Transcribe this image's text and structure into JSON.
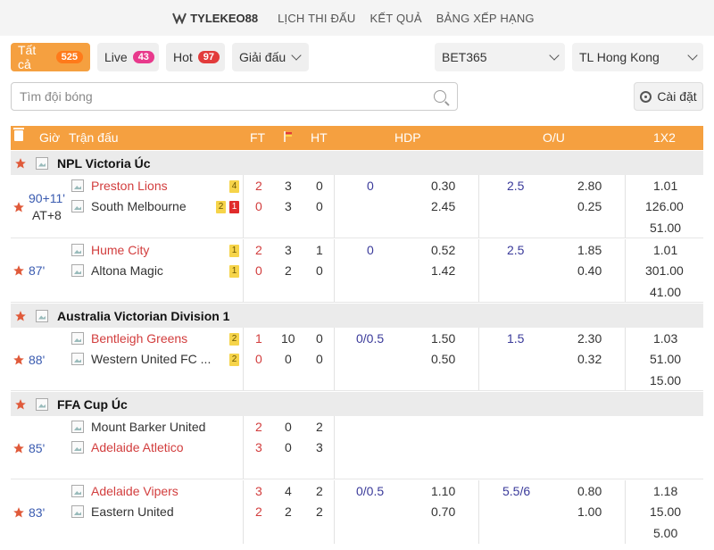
{
  "nav": {
    "brand": "TYLEKEO88",
    "links": [
      "LỊCH THI ĐẤU",
      "KẾT QUẢ",
      "BẢNG XẾP HẠNG"
    ]
  },
  "filters": {
    "all": {
      "label": "Tất cả",
      "count": "525"
    },
    "live": {
      "label": "Live",
      "count": "43"
    },
    "hot": {
      "label": "Hot",
      "count": "97"
    },
    "league": {
      "label": "Giải đấu"
    },
    "bookmaker": {
      "value": "BET365"
    },
    "odds_type": {
      "value": "TL Hong Kong"
    }
  },
  "search": {
    "placeholder": "Tìm đội bóng"
  },
  "settings": {
    "label": "Cài đặt"
  },
  "table_header": {
    "time": "Giờ",
    "match": "Trận đấu",
    "ft": "FT",
    "ht": "HT",
    "hdp": "HDP",
    "ou": "O/U",
    "x12": "1X2"
  },
  "colors": {
    "accent": "#f5a040",
    "team_red": "#d23d3d",
    "odds_blue": "#3a3a9a",
    "minute_blue": "#3a5bb0"
  },
  "leagues": [
    {
      "name": "NPL Victoria Úc"
    },
    {
      "name": "Australia Victorian Division 1"
    },
    {
      "name": "FFA Cup Úc"
    }
  ],
  "matches": [
    {
      "time1": "90+11'",
      "time2": "AT+8",
      "home": "Preston Lions",
      "away": "South Melbourne",
      "home_cards": [
        "4"
      ],
      "away_cards": [
        "2",
        "1"
      ],
      "ft": [
        "2",
        "0"
      ],
      "corners": [
        "3",
        "3"
      ],
      "ht": [
        "0",
        "0"
      ],
      "hdp_line": "0",
      "hdp_odds": [
        "0.30",
        "2.45"
      ],
      "ou_line": "2.5",
      "ou_odds": [
        "2.80",
        "0.25"
      ],
      "x12": [
        "1.01",
        "126.00",
        "51.00"
      ]
    },
    {
      "time1": "87'",
      "home": "Hume City",
      "away": "Altona Magic",
      "home_cards": [
        "1"
      ],
      "away_cards": [
        "1"
      ],
      "ft": [
        "2",
        "0"
      ],
      "corners": [
        "3",
        "2"
      ],
      "ht": [
        "1",
        "0"
      ],
      "hdp_line": "0",
      "hdp_odds": [
        "0.52",
        "1.42"
      ],
      "ou_line": "2.5",
      "ou_odds": [
        "1.85",
        "0.40"
      ],
      "x12": [
        "1.01",
        "301.00",
        "41.00"
      ]
    },
    {
      "time1": "88'",
      "home": "Bentleigh Greens",
      "away": "Western United FC ...",
      "home_cards": [
        "2"
      ],
      "away_cards": [
        "2"
      ],
      "ft": [
        "1",
        "0"
      ],
      "corners": [
        "10",
        "0"
      ],
      "ht": [
        "0",
        "0"
      ],
      "hdp_line": "0/0.5",
      "hdp_odds": [
        "1.50",
        "0.50"
      ],
      "ou_line": "1.5",
      "ou_odds": [
        "2.30",
        "0.32"
      ],
      "x12": [
        "1.03",
        "51.00",
        "15.00"
      ]
    },
    {
      "time1": "85'",
      "home": "Mount Barker United",
      "away": "Adelaide Atletico",
      "ft": [
        "2",
        "3"
      ],
      "corners": [
        "0",
        "0"
      ],
      "ht": [
        "2",
        "3"
      ]
    },
    {
      "time1": "83'",
      "home": "Adelaide Vipers",
      "away": "Eastern United",
      "ft": [
        "3",
        "2"
      ],
      "corners": [
        "4",
        "2"
      ],
      "ht": [
        "2",
        "2"
      ],
      "hdp_line": "0/0.5",
      "hdp_odds": [
        "1.10",
        "0.70"
      ],
      "ou_line": "5.5/6",
      "ou_odds": [
        "0.80",
        "1.00"
      ],
      "x12": [
        "1.18",
        "15.00",
        "5.00"
      ]
    }
  ]
}
